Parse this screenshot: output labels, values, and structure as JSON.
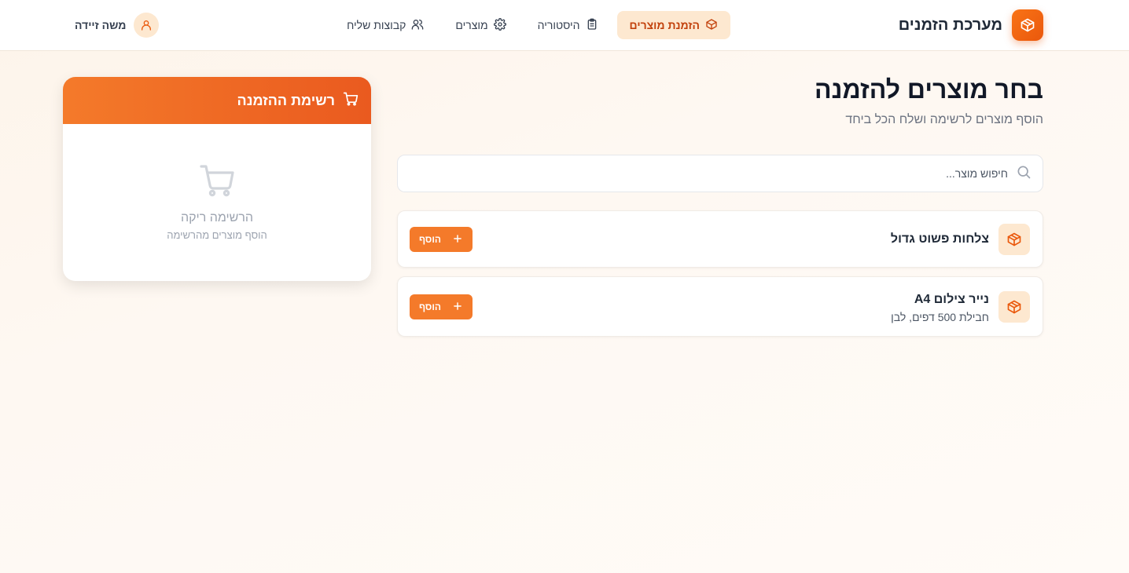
{
  "app": {
    "title": "מערכת הזמנים"
  },
  "nav": {
    "items": [
      {
        "label": "הזמנת מוצרים",
        "icon": "package-icon",
        "active": true
      },
      {
        "label": "היסטוריה",
        "icon": "clipboard-icon",
        "active": false
      },
      {
        "label": "מוצרים",
        "icon": "gear-icon",
        "active": false
      },
      {
        "label": "קבוצות שליח",
        "icon": "users-icon",
        "active": false
      }
    ]
  },
  "user": {
    "name": "משה זיידה",
    "icon": "user-icon"
  },
  "main": {
    "title": "בחר מוצרים להזמנה",
    "subtitle": "הוסף מוצרים לרשימה ושלח הכל ביחד",
    "search": {
      "placeholder": "חיפוש מוצר...",
      "value": ""
    },
    "products": [
      {
        "name": "צלחות פשוט גדול",
        "description": "",
        "add_label": "הוסף",
        "icon": "package-icon"
      },
      {
        "name": "נייר צילום A4",
        "description": "חבילת 500 דפים, לבן",
        "add_label": "הוסף",
        "icon": "package-icon"
      }
    ]
  },
  "cart": {
    "title": "רשימת ההזמנה",
    "empty_title": "הרשימה ריקה",
    "empty_subtitle": "הוסף מוצרים מהרשימה",
    "icon": "cart-icon"
  },
  "colors": {
    "accent": "#f47a2a",
    "accent_dark": "#ea580c",
    "accent_soft": "#fde8d0",
    "active_text": "#c2410c"
  }
}
